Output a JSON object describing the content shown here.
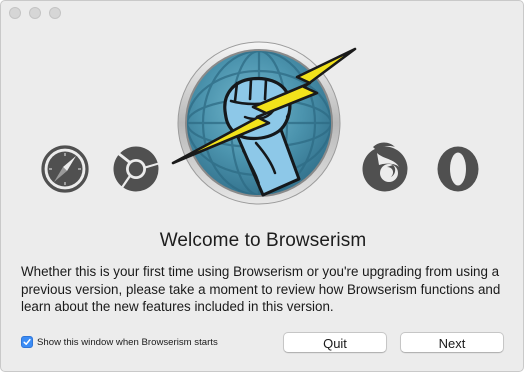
{
  "window": {
    "welcome_title": "Welcome to Browserism",
    "description": "Whether this is your first time using Browserism or you're upgrading from using a previous version, please take a moment to review how Browserism functions and learn about the new features included in this version."
  },
  "startup_option": {
    "label": "Show this window when Browserism starts",
    "checked": true
  },
  "buttons": {
    "quit": "Quit",
    "next": "Next"
  },
  "icons": [
    "safari-icon",
    "chrome-icon",
    "browserism-logo",
    "firefox-icon",
    "opera-icon"
  ],
  "colors": {
    "window_bg": "#ececec",
    "browser_icon": "#505050",
    "logo_globe": "#4a90a8",
    "lightning": "#f2e21b",
    "fist": "#8dc8e8",
    "checkbox": "#3b8cf5"
  }
}
